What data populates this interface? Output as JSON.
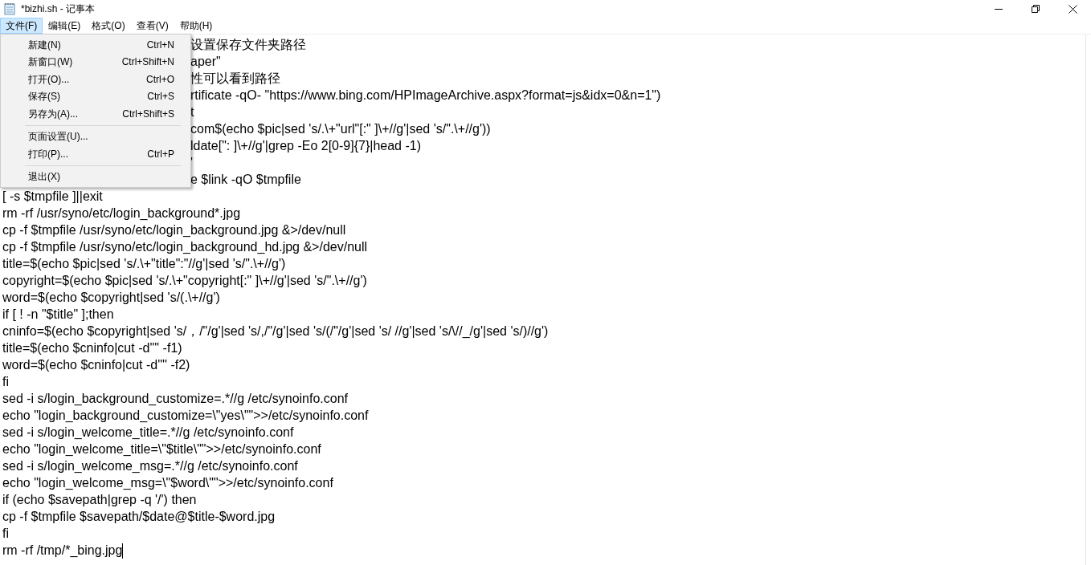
{
  "window": {
    "title": "*bizhi.sh - 记事本"
  },
  "menu_bar": [
    {
      "label": "文件(F)",
      "selected": true
    },
    {
      "label": "编辑(E)",
      "selected": false
    },
    {
      "label": "格式(O)",
      "selected": false
    },
    {
      "label": "查看(V)",
      "selected": false
    },
    {
      "label": "帮助(H)",
      "selected": false
    }
  ],
  "file_menu": [
    {
      "kind": "item",
      "label": "新建(N)",
      "shortcut": "Ctrl+N"
    },
    {
      "kind": "item",
      "label": "新窗口(W)",
      "shortcut": "Ctrl+Shift+N"
    },
    {
      "kind": "item",
      "label": "打开(O)...",
      "shortcut": "Ctrl+O"
    },
    {
      "kind": "item",
      "label": "保存(S)",
      "shortcut": "Ctrl+S"
    },
    {
      "kind": "item",
      "label": "另存为(A)...",
      "shortcut": "Ctrl+Shift+S"
    },
    {
      "kind": "separator"
    },
    {
      "kind": "item",
      "label": "页面设置(U)..."
    },
    {
      "kind": "item",
      "label": "打印(P)...",
      "shortcut": "Ctrl+P"
    },
    {
      "kind": "separator"
    },
    {
      "kind": "item",
      "label": "退出(X)"
    }
  ],
  "editor": {
    "lines": [
      {
        "text": "设置保存文件夹路径",
        "behind_menu": true
      },
      {
        "text": "aper\"",
        "behind_menu": true
      },
      {
        "text": "性可以看到路径",
        "behind_menu": true
      },
      {
        "text": "rtificate -qO- \"https://www.bing.com/HPImageArchive.aspx?format=js&idx=0&n=1\")",
        "behind_menu": true
      },
      {
        "text": "t",
        "behind_menu": true
      },
      {
        "text": "com$(echo $pic|sed 's/.\\+\"url\"[:\" ]\\+//g'|sed 's/\".\\+//g'))",
        "behind_menu": true
      },
      {
        "text": "ldate[\": ]\\+//g'|grep -Eo 2[0-9]{7}|head -1)",
        "behind_menu": true
      },
      {
        "text": "'",
        "behind_menu": true
      },
      {
        "text": "e $link -qO $tmpfile",
        "behind_menu": true
      },
      {
        "text": "[ -s $tmpfile ]||exit"
      },
      {
        "text": "rm -rf /usr/syno/etc/login_background*.jpg"
      },
      {
        "text": "cp -f $tmpfile /usr/syno/etc/login_background.jpg &>/dev/null"
      },
      {
        "text": "cp -f $tmpfile /usr/syno/etc/login_background_hd.jpg &>/dev/null"
      },
      {
        "text": "title=$(echo $pic|sed 's/.\\+\"title\":\"//g'|sed 's/\".\\+//g')"
      },
      {
        "text": "copyright=$(echo $pic|sed 's/.\\+\"copyright[:\" ]\\+//g'|sed 's/\".\\+//g')"
      },
      {
        "text": "word=$(echo $copyright|sed 's/(.\\+//g')"
      },
      {
        "text": "if [ ! -n \"$title\" ];then"
      },
      {
        "text": "cninfo=$(echo $copyright|sed 's/，/\"/g'|sed 's/,/\"/g'|sed 's/(/\"/g'|sed 's/ //g'|sed 's/\\//_/g'|sed 's/)//g')"
      },
      {
        "text": "title=$(echo $cninfo|cut -d'\"' -f1)"
      },
      {
        "text": "word=$(echo $cninfo|cut -d'\"' -f2)"
      },
      {
        "text": "fi"
      },
      {
        "text": "sed -i s/login_background_customize=.*//g /etc/synoinfo.conf"
      },
      {
        "text": "echo \"login_background_customize=\\\"yes\\\"\">>/etc/synoinfo.conf"
      },
      {
        "text": "sed -i s/login_welcome_title=.*//g /etc/synoinfo.conf"
      },
      {
        "text": "echo \"login_welcome_title=\\\"$title\\\"\">>/etc/synoinfo.conf"
      },
      {
        "text": "sed -i s/login_welcome_msg=.*//g /etc/synoinfo.conf"
      },
      {
        "text": "echo \"login_welcome_msg=\\\"$word\\\"\">>/etc/synoinfo.conf"
      },
      {
        "text": "if (echo $savepath|grep -q '/') then"
      },
      {
        "text": "cp -f $tmpfile $savepath/$date@$title-$word.jpg"
      },
      {
        "text": "fi"
      },
      {
        "text": "rm -rf /tmp/*_bing.jpg"
      }
    ]
  }
}
